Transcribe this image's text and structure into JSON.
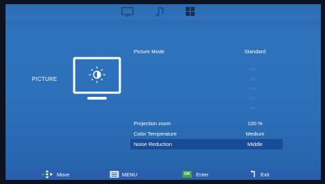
{
  "tabs": [
    {
      "icon": "tv-icon",
      "active": false
    },
    {
      "icon": "music-note-icon",
      "active": false
    },
    {
      "icon": "setup-grid-icon",
      "active": true
    }
  ],
  "section": {
    "label": "PICTURE",
    "icon": "monitor-brightness-icon"
  },
  "menu": {
    "picture_mode": {
      "label": "Picture Mode",
      "value": "Standard"
    },
    "projection_zoom": {
      "label": "Projection zoom",
      "value": "100 %"
    },
    "color_temperature": {
      "label": "Color Temperature",
      "value": "Medium"
    },
    "noise_reduction": {
      "label": "Noise Reduction",
      "value": "Middle"
    }
  },
  "bottom_bar": {
    "move": {
      "label": "Move",
      "icon": "dpad-icon"
    },
    "menu": {
      "label": "MENU",
      "icon": "menu-icon"
    },
    "enter": {
      "label": "Enter",
      "key": "OK"
    },
    "exit": {
      "label": "Exit",
      "icon": "return-arrow-icon"
    }
  },
  "colors": {
    "panel": "#2f73bd",
    "selected_row": "#1a4b95",
    "bottom_bar": "#2a5fae",
    "ok_key": "#3fa14a"
  }
}
